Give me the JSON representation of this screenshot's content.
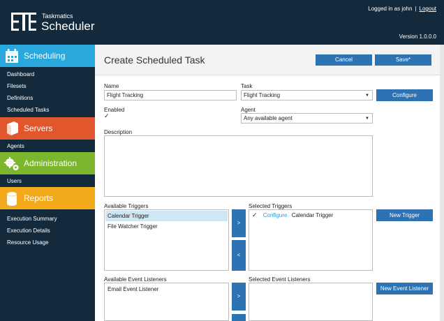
{
  "header": {
    "brand_small": "Taskmatics",
    "brand_big": "Scheduler",
    "logged_in": "Logged in as john",
    "separator": "|",
    "logout": "Logout",
    "version": "Version 1.0.0.0"
  },
  "sidebar": {
    "sections": [
      {
        "title": "Scheduling",
        "items": [
          "Dashboard",
          "Filesets",
          "Definitions",
          "Scheduled Tasks"
        ]
      },
      {
        "title": "Servers",
        "items": [
          "Agents"
        ]
      },
      {
        "title": "Administration",
        "items": [
          "Users"
        ]
      },
      {
        "title": "Reports",
        "items": [
          "Execution Summary",
          "Execution Details",
          "Resource Usage"
        ]
      }
    ]
  },
  "page": {
    "title": "Create Scheduled Task",
    "cancel": "Cancel",
    "save": "Save*"
  },
  "form": {
    "name_label": "Name",
    "name_value": "Flight Tracking",
    "task_label": "Task",
    "task_value": "Flight Tracking",
    "configure": "Configure",
    "enabled_label": "Enabled",
    "agent_label": "Agent",
    "agent_value": "Any available agent",
    "description_label": "Description",
    "description_value": ""
  },
  "triggers": {
    "available_label": "Available Triggers",
    "available": [
      "Calendar Trigger",
      "File Watcher Trigger"
    ],
    "selected_label": "Selected Triggers",
    "selected_configure": "Configure",
    "selected_name": "Calendar Trigger",
    "add_arrow": ">",
    "remove_arrow": "<",
    "new_trigger": "New Trigger"
  },
  "listeners": {
    "available_label": "Available Event Listeners",
    "available": [
      "Email Event Listener"
    ],
    "selected_label": "Selected Event Listeners",
    "add_arrow": ">",
    "new_listener": "New Event Listener"
  },
  "colors": {
    "dark": "#122a3c",
    "scheduling": "#2aa8de",
    "servers": "#e2562e",
    "administration": "#7cb62e",
    "reports": "#f2a91a",
    "button": "#2d73b4"
  },
  "icons": {
    "logo": "taskmatics-logo",
    "scheduling": "calendar-icon",
    "servers": "server-box-icon",
    "administration": "gears-icon",
    "reports": "database-icon",
    "check": "checkmark-icon",
    "caret": "chevron-down-icon"
  }
}
